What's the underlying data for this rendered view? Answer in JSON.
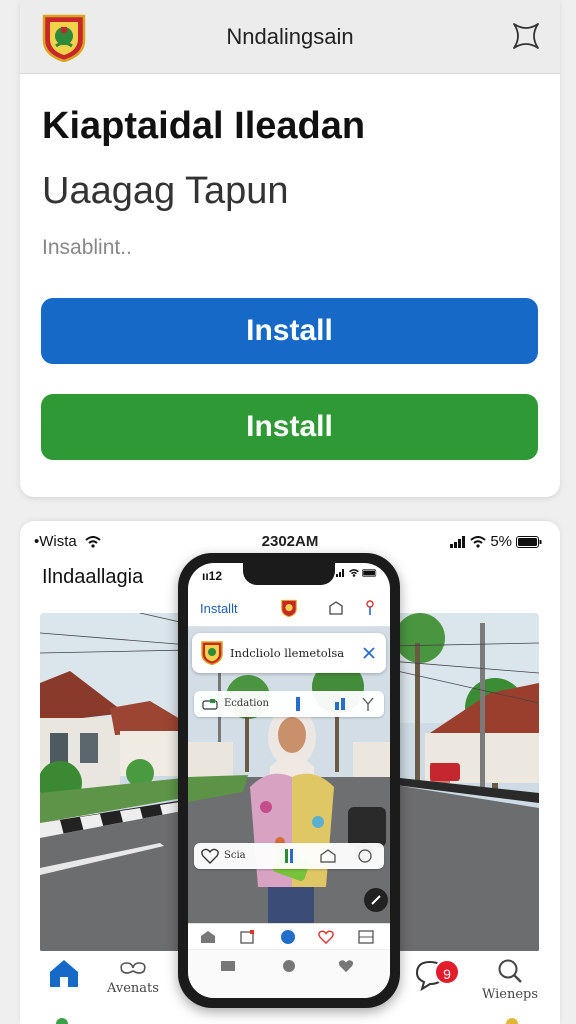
{
  "install_card": {
    "header_title": "Nndalingsain",
    "headline": "Kiaptaidal Ileadan",
    "subheadline": "Uaagag Tapun",
    "status": "Insablint..",
    "primary_button": "Install",
    "secondary_button": "Install",
    "colors": {
      "primary": "#1669c7",
      "secondary": "#2f9a35"
    }
  },
  "preview": {
    "status_bar": {
      "carrier": "•Wista",
      "time": "2302AM",
      "battery": "5%"
    },
    "feed_title": "Ilndaallagia",
    "tabs": [
      {
        "label": "",
        "icon": "home-icon",
        "active": true
      },
      {
        "label": "Avenats",
        "icon": "link-icon"
      },
      {
        "label": "",
        "icon": "chat-icon",
        "badge": "9"
      },
      {
        "label": "Wieneps",
        "icon": "search-icon"
      }
    ]
  },
  "phone": {
    "time": "ıı12",
    "toolbar_label": "Installt",
    "notification_text": "Indcliolo llemetolsa",
    "pill_top_label": "Ecdation",
    "pill_bottom_label": "Scia"
  }
}
